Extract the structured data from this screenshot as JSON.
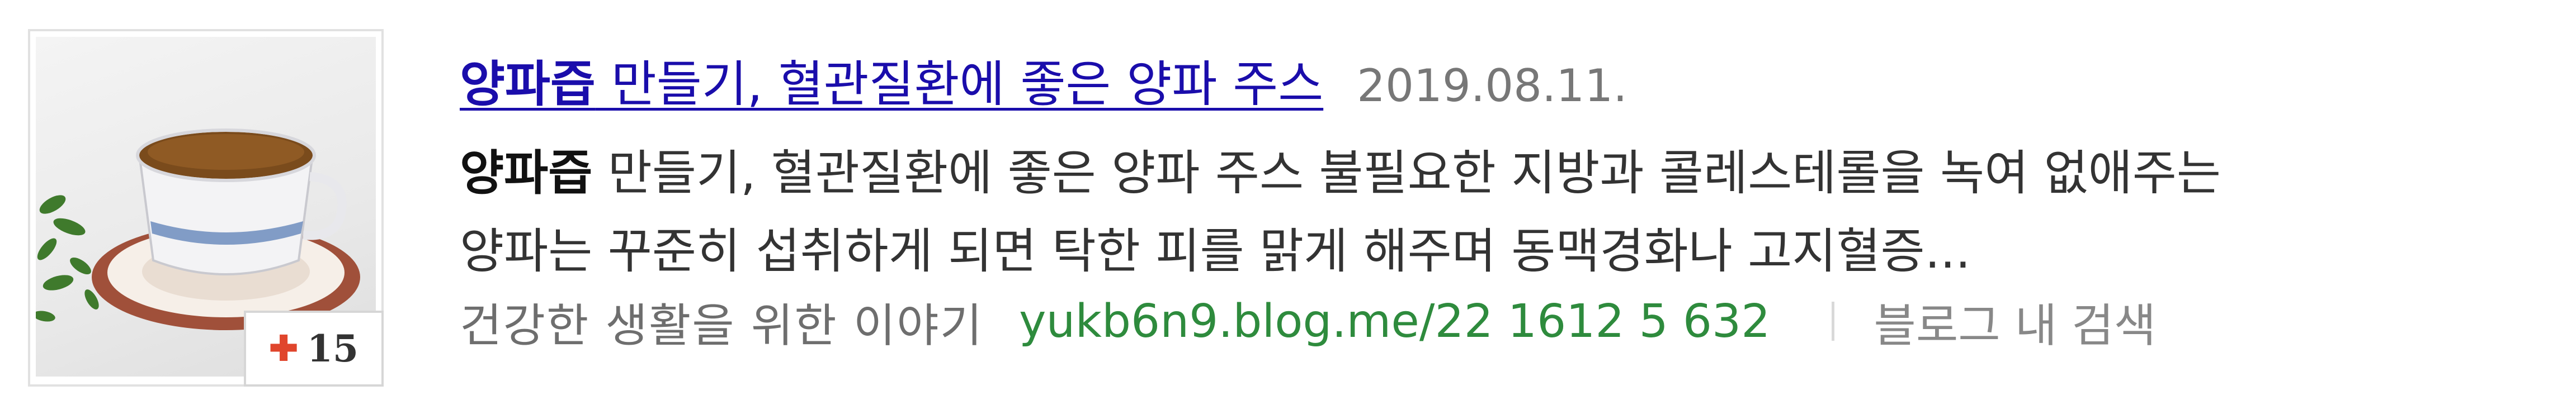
{
  "result": {
    "thumbnail": {
      "alt_icon": "tea-cup-image",
      "count_prefix_icon": "plus-icon",
      "count": "15"
    },
    "title": {
      "emphasis": "양파즙",
      "rest": " 만들기, 혈관질환에 좋은 양파 주스"
    },
    "date": "2019.08.11.",
    "snippet": {
      "emphasis": "양파즙",
      "line1_rest": " 만들기, 혈관질환에 좋은 양파 주스 불필요한 지방과 콜레스테롤을 녹여 없애주는",
      "line2": "양파는 꾸준히 섭취하게 되면 탁한 피를 맑게 해주며 동맥경화나 고지혈증..."
    },
    "source": {
      "blog_name": "건강한 생활을 위한 이야기",
      "url": "yukb6n9.blog.me/22 1612 5 632",
      "in_blog_search": "블로그 내 검색"
    }
  },
  "colors": {
    "title_link": "#1a0dab",
    "url_green": "#2e8b3d",
    "badge_plus": "#e0452c"
  }
}
